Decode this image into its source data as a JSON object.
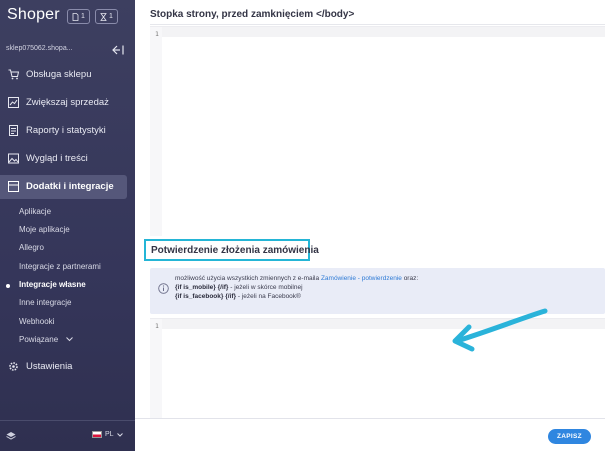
{
  "app": {
    "logo": "Shoper",
    "badge_pages_count": "1",
    "badge_hourglass_count": "1",
    "shop_name": "sklep075062.shopa..."
  },
  "sidebar": {
    "items": [
      {
        "label": "Obsługa sklepu",
        "icon": "cart-icon"
      },
      {
        "label": "Zwiększaj sprzedaż",
        "icon": "chart-icon"
      },
      {
        "label": "Raporty i statystyki",
        "icon": "report-icon"
      },
      {
        "label": "Wygląd i treści",
        "icon": "image-icon"
      },
      {
        "label": "Dodatki i integracje",
        "icon": "addons-icon",
        "active": true
      }
    ],
    "subitems": [
      {
        "label": "Aplikacje"
      },
      {
        "label": "Moje aplikacje"
      },
      {
        "label": "Allegro"
      },
      {
        "label": "Integracje z partnerami"
      },
      {
        "label": "Integracje własne",
        "current": true
      },
      {
        "label": "Inne integracje"
      },
      {
        "label": "Webhooki"
      },
      {
        "label": "Powiązane"
      }
    ],
    "settings_label": "Ustawienia",
    "language": "PL"
  },
  "main": {
    "section1_title": "Stopka strony, przed zamknięciem </body>",
    "editor1_line": "1",
    "section2_title": "Potwierdzenie złożenia zamówienia",
    "info": {
      "line1_prefix": "możliwość użycia wszystkich zmiennych z e-maila",
      "line1_link": "Zamówienie - potwierdzenie",
      "line1_suffix": "oraz:",
      "line2_code": "{if is_mobile}     {/if}",
      "line2_desc": "- jeżeli w skórce mobilnej",
      "line3_code": "{if is_facebook}     {/if}",
      "line3_desc": "- jeżeli na Facebook®"
    },
    "editor2_line": "1",
    "save_label": "ZAPISZ"
  },
  "colors": {
    "sidebar_bg": "#3d3f60",
    "highlight_border": "#24b5d6",
    "arrow": "#2ab3da",
    "link": "#2f7bd6",
    "save_button": "#2f86e0"
  }
}
